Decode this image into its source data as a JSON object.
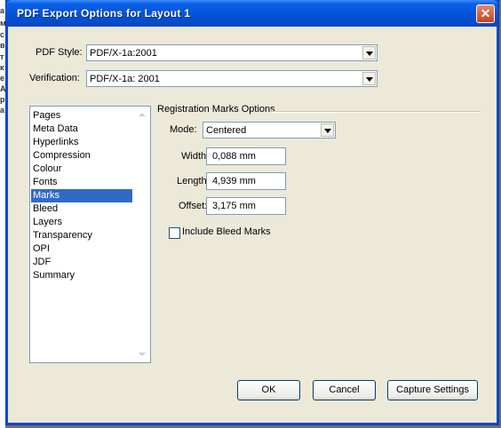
{
  "window": {
    "title": "PDF Export Options for Layout 1",
    "close_glyph": "✕"
  },
  "pdf_style": {
    "label": "PDF Style:",
    "value": "PDF/X-1a:2001"
  },
  "verification": {
    "label": "Verification:",
    "value": "PDF/X-1a: 2001"
  },
  "sections": [
    "Pages",
    "Meta Data",
    "Hyperlinks",
    "Compression",
    "Colour",
    "Fonts",
    "Marks",
    "Bleed",
    "Layers",
    "Transparency",
    "OPI",
    "JDF",
    "Summary"
  ],
  "selected_section": "Marks",
  "registration": {
    "group_label": "Registration Marks Options",
    "mode_label": "Mode:",
    "mode_value": "Centered",
    "width_label": "Width:",
    "width_value": "0,088 mm",
    "length_label": "Length:",
    "length_value": "4,939 mm",
    "offset_label": "Offset:",
    "offset_value": "3,175 mm",
    "include_bleed_label": "Include Bleed Marks",
    "include_bleed_checked": false
  },
  "buttons": {
    "ok": "OK",
    "cancel": "Cancel",
    "capture": "Capture Settings"
  },
  "background": {
    "edge_letters": [
      "а",
      "м",
      "с",
      "в",
      "т",
      "к",
      "е",
      "A",
      "р",
      "а"
    ]
  }
}
